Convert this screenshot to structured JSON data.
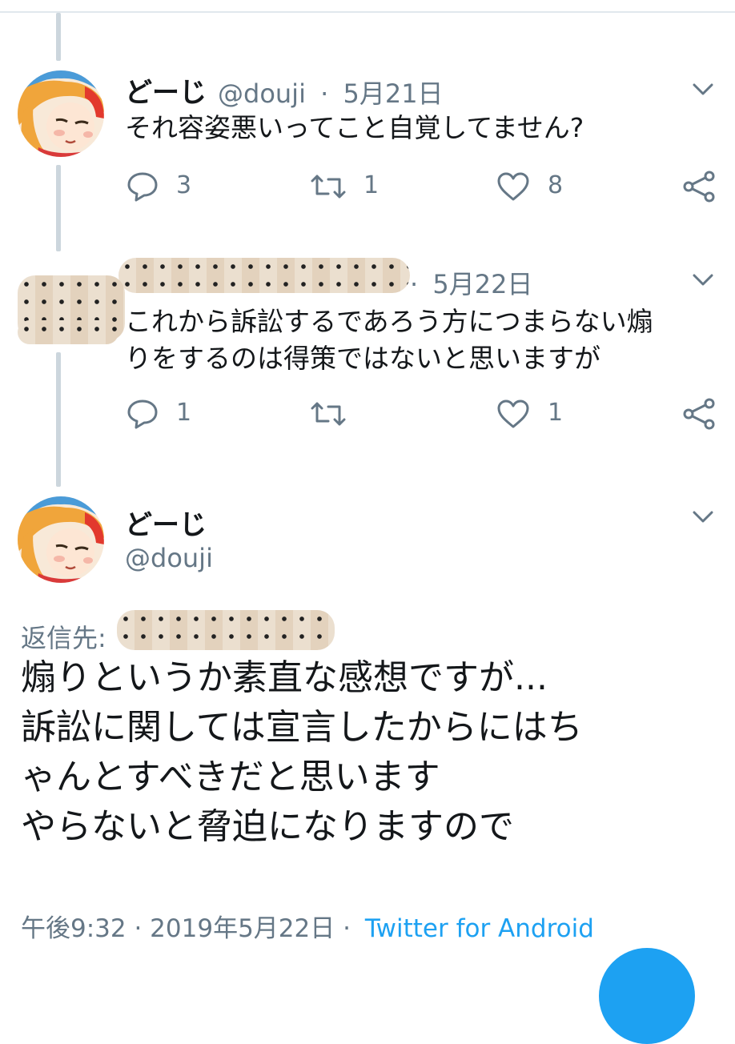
{
  "tweet1": {
    "name": "どーじ",
    "handle": "@douji",
    "dot": "·",
    "date": "5月21日",
    "text": "それ容姿悪いってこと自覚してません?",
    "replies": "3",
    "retweets": "1",
    "likes": "8"
  },
  "tweet2": {
    "date": "5月22日",
    "text_line1": "これから訴訟するであろう方につまらない煽",
    "text_line2": "りをするのは得策ではないと思いますが",
    "replies": "1",
    "retweets": "",
    "likes": "1"
  },
  "main_tweet": {
    "name": "どーじ",
    "handle": "@douji",
    "reply_to_label": "返信先:",
    "lines": [
      "煽りというか素直な感想ですが...",
      "訴訟に関しては宣言したからにはち",
      "ゃんとすべきだと思います",
      "やらないと脅迫になりますので"
    ],
    "timestamp": "午後9:32 · 2019年5月22日 ·",
    "source": "Twitter for Android"
  },
  "colors": {
    "accent": "#1da1f2",
    "muted": "#657786",
    "thread_line": "#ccd6dd"
  },
  "icons": [
    "reply-icon",
    "retweet-icon",
    "like-icon",
    "share-icon",
    "chevron-down-icon"
  ]
}
